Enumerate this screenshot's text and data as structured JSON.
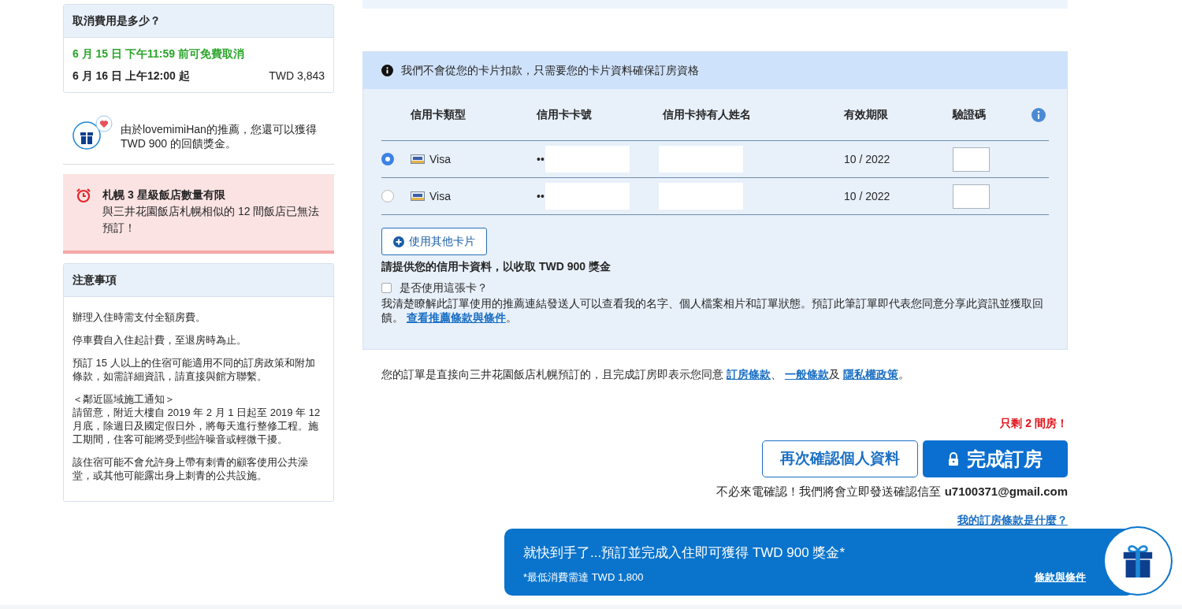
{
  "cancellation": {
    "title": "取消費用是多少？",
    "free_until": "6 月 15 日 下午11:59 前可免費取消",
    "fee_from": "6 月 16 日 上午12:00 起",
    "fee_amount": "TWD 3,843"
  },
  "referral": {
    "text": "由於lovemimiHan的推薦，您還可以獲得 TWD 900 的回饋獎金。"
  },
  "alert": {
    "title": "札幌 3 星級飯店數量有限",
    "text": "與三井花園飯店札幌相似的 12 間飯店已無法預訂！"
  },
  "notes": {
    "title": "注意事項",
    "paragraphs": [
      [
        "辦理入住時需支付全額房費。"
      ],
      [
        "停車費自入住起計費，至退房時為止。"
      ],
      [
        "預訂 15 人以上的住宿可能適用不同的訂房政策和附加條款，如需詳細資訊，請直接與館方聯繫。"
      ],
      [
        "＜鄰近區域施工通知＞",
        "請留意，附近大樓自 2019 年 2 月 1 日起至 2019 年 12 月底，除週日及國定假日外，將每天進行整修工程。施工期間，住客可能將受到些許噪音或輕微干擾。"
      ],
      [
        "該住宿可能不會允許身上帶有刺青的顧客使用公共澡堂，或其他可能露出身上刺青的公共設施。"
      ]
    ]
  },
  "card_notice": "我們不會從您的卡片扣款，只需要您的卡片資料確保訂房資格",
  "card_table": {
    "columns": [
      "信用卡類型",
      "信用卡卡號",
      "信用卡持有人姓名",
      "有效期限",
      "驗證碼"
    ],
    "rows": [
      {
        "selected": true,
        "type": "Visa",
        "number": "••",
        "expiry": "10 / 2022"
      },
      {
        "selected": false,
        "type": "Visa",
        "number": "••",
        "expiry": "10 / 2022"
      }
    ]
  },
  "add_card_button": "使用其他卡片",
  "reward_title": "請提供您的信用卡資料，以收取 TWD 900 獎金",
  "use_card": {
    "label": "是否使用這張卡？",
    "checked": false
  },
  "consent": {
    "text": "我清楚瞭解此訂單使用的推薦連結發送人可以查看我的名字、個人檔案相片和訂單狀態。預訂此筆訂單即代表您同意分享此資訊並獲取回饋。 ",
    "link": "查看推薦條款與條件",
    "end": "。"
  },
  "terms": [
    {
      "kind": "text",
      "text": "您的訂單是直接向三井花園飯店札幌預訂的，且完成訂房即表示您同意 "
    },
    {
      "kind": "link",
      "text": "訂房條款"
    },
    {
      "kind": "text",
      "text": "、 "
    },
    {
      "kind": "link",
      "text": "一般條款"
    },
    {
      "kind": "text",
      "text": "及 "
    },
    {
      "kind": "link",
      "text": "隱私權政策"
    },
    {
      "kind": "text",
      "text": "。"
    }
  ],
  "scarcity": "只剩 2 間房！",
  "review_button": "再次確認個人資料",
  "book_button": "完成訂房",
  "confirmation": {
    "text": "不必來電確認！我們將會立即發送確認信至 ",
    "email": "u7100371@gmail.com"
  },
  "terms_question": "我的訂房條款是什麼？",
  "banner": {
    "title": "就快到手了...預訂並完成入住即可獲得 TWD 900 獎金*",
    "subtitle": "*最低消費需達 TWD 1,800",
    "link": "條款與條件"
  }
}
